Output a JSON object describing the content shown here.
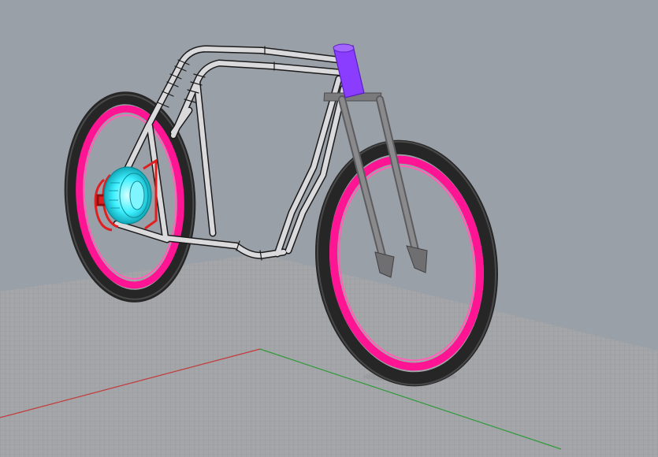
{
  "viewport": {
    "view_type": "perspective",
    "display_mode": "shaded",
    "grid_visible": true
  },
  "colors": {
    "background": "#9aa0a8",
    "grid_plane": "#a3a5a8",
    "grid_line": "#8d9094",
    "x_axis": "#c43a3a",
    "y_axis": "#2f9a3a",
    "tire": "#2b2b2b",
    "rim": "#ff1493",
    "hub_motor": "#3ff0ff",
    "brake_caliper": "#e02020",
    "frame_tube": "#d9d9dc",
    "head_tube": "#8a3cff",
    "fork": "#7d7d80"
  },
  "model": {
    "object": "bicycle",
    "parts": [
      "frame",
      "front-wheel",
      "rear-wheel",
      "fork",
      "head-tube",
      "hub-motor",
      "brake-caliper"
    ]
  }
}
